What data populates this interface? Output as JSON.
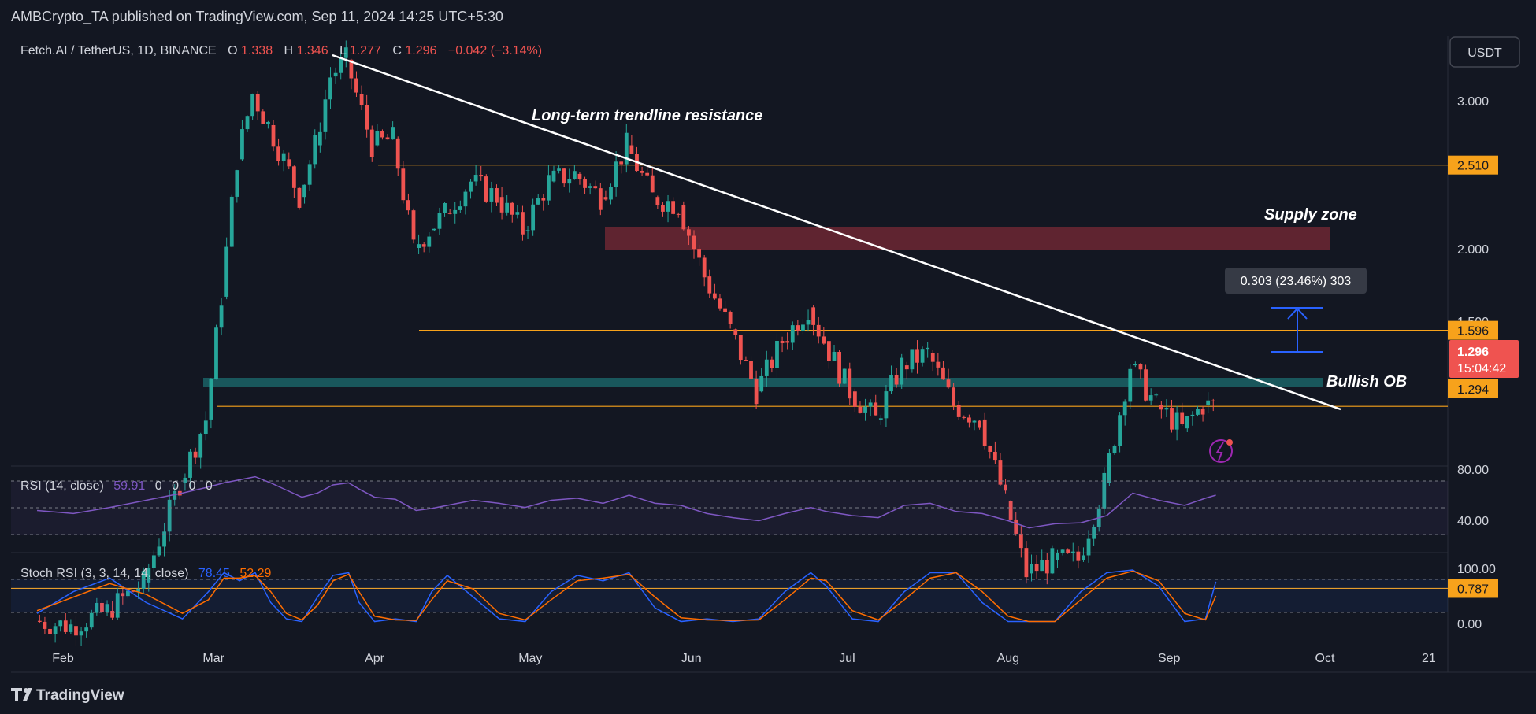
{
  "header": {
    "published_by": "AMBCrypto_TA published on TradingView.com, Sep 11, 2024 14:25 UTC+5:30"
  },
  "legend": {
    "symbol": "Fetch.AI / TetherUS, 1D, BINANCE",
    "o_label": "O",
    "o_value": "1.338",
    "h_label": "H",
    "h_value": "1.346",
    "l_label": "L",
    "l_value": "1.277",
    "c_label": "C",
    "c_value": "1.296",
    "change": "−0.042 (−3.14%)"
  },
  "currency_button": "USDT",
  "footer": {
    "logo_text": "TradingView"
  },
  "colors": {
    "background": "#131722",
    "up": "#26a69a",
    "down": "#ef5350",
    "level_line": "#f7a21b",
    "trendline": "#ffffff",
    "supply_zone": "#7a2a35",
    "bullish_ob": "#1b5e63",
    "rsi": "#7e57c2",
    "stoch_k": "#2962ff",
    "stoch_d": "#ff6d00",
    "measure": "#2962ff"
  },
  "chart_data": [
    {
      "type": "candlestick",
      "title": "Fetch.AI / TetherUS, 1D, BINANCE",
      "x_tick_labels": [
        "Feb",
        "Mar",
        "Apr",
        "May",
        "Jun",
        "Jul",
        "Aug",
        "Sep",
        "Oct",
        "21"
      ],
      "y_tick_labels": [
        "3.000",
        "2.000",
        "1.500"
      ],
      "ylim": [
        0.6,
        3.7
      ],
      "y_scale": "log",
      "grid": false,
      "series": [
        {
          "x": [
            "2024-01-27",
            "2024-02-03",
            "2024-02-10",
            "2024-02-17",
            "2024-02-24",
            "2024-02-29",
            "2024-03-03",
            "2024-03-06",
            "2024-03-09",
            "2024-03-12",
            "2024-03-15",
            "2024-03-18",
            "2024-03-21",
            "2024-03-24",
            "2024-03-27",
            "2024-03-29",
            "2024-04-01",
            "2024-04-05",
            "2024-04-09",
            "2024-04-12",
            "2024-04-15",
            "2024-04-20",
            "2024-04-25",
            "2024-04-30",
            "2024-05-05",
            "2024-05-10",
            "2024-05-15",
            "2024-05-20",
            "2024-05-25",
            "2024-05-30",
            "2024-06-04",
            "2024-06-09",
            "2024-06-14",
            "2024-06-19",
            "2024-06-24",
            "2024-06-27",
            "2024-07-02",
            "2024-07-07",
            "2024-07-12",
            "2024-07-17",
            "2024-07-22",
            "2024-07-27",
            "2024-08-01",
            "2024-08-05",
            "2024-08-10",
            "2024-08-15",
            "2024-08-20",
            "2024-08-25",
            "2024-08-30",
            "2024-09-04",
            "2024-09-08",
            "2024-09-10"
          ],
          "close": [
            0.72,
            0.71,
            0.74,
            0.8,
            1.05,
            1.25,
            1.75,
            2.55,
            3.05,
            2.8,
            2.55,
            2.3,
            2.65,
            3.2,
            3.35,
            3.05,
            2.65,
            2.7,
            2.0,
            2.1,
            2.2,
            2.4,
            2.3,
            2.1,
            2.4,
            2.45,
            2.3,
            2.65,
            2.3,
            2.25,
            1.85,
            1.6,
            1.35,
            1.55,
            1.7,
            1.55,
            1.35,
            1.25,
            1.45,
            1.5,
            1.3,
            1.25,
            1.0,
            0.82,
            0.85,
            0.85,
            1.05,
            1.45,
            1.3,
            1.22,
            1.3,
            1.296
          ]
        }
      ],
      "levels": [
        {
          "label": "2.510",
          "value": 2.51
        },
        {
          "label": "1.596",
          "value": 1.596
        },
        {
          "label": "1.296",
          "value": 1.296
        },
        {
          "label": "1.294",
          "value": 1.294
        },
        {
          "label": "0.787",
          "value": 0.787
        }
      ],
      "price_tag": {
        "value": "1.296",
        "countdown": "15:04:42"
      },
      "annotations": {
        "trendline": "Long-term trendline resistance",
        "supply_zone": "Supply zone",
        "bullish_ob": "Bullish OB",
        "measure": "0.303 (23.46%) 303"
      },
      "zones": [
        {
          "name": "Supply zone",
          "from": 2.0,
          "to": 2.2
        },
        {
          "name": "Bullish OB",
          "from": 1.17,
          "to": 1.21
        }
      ]
    },
    {
      "type": "line",
      "title": "RSI (14, close)",
      "legend_values": [
        "59.91",
        "0",
        "0",
        "0",
        "0"
      ],
      "y_tick_labels": [
        "80.00",
        "40.00"
      ],
      "ylim": [
        20,
        85
      ],
      "band": [
        30,
        70
      ],
      "series": [
        {
          "name": "RSI",
          "values": [
            45,
            42,
            48,
            55,
            62,
            68,
            72,
            75,
            78,
            72,
            65,
            58,
            62,
            70,
            72,
            66,
            58,
            56,
            45,
            47,
            50,
            55,
            52,
            48,
            55,
            57,
            52,
            60,
            52,
            50,
            42,
            38,
            35,
            42,
            48,
            44,
            40,
            38,
            50,
            52,
            44,
            42,
            35,
            28,
            32,
            33,
            40,
            62,
            55,
            50,
            57,
            60
          ]
        }
      ]
    },
    {
      "type": "line",
      "title": "Stoch RSI (3, 3, 14, 14, close)",
      "legend_values": [
        "78.45",
        "52.29"
      ],
      "y_tick_labels": [
        "100.00",
        "0.00"
      ],
      "ylim": [
        -8,
        112
      ],
      "band": [
        20,
        80
      ],
      "series": [
        {
          "name": "K",
          "values": [
            20,
            60,
            85,
            40,
            10,
            60,
            95,
            80,
            95,
            40,
            10,
            5,
            50,
            90,
            95,
            40,
            5,
            10,
            5,
            60,
            90,
            50,
            10,
            5,
            60,
            90,
            80,
            95,
            30,
            5,
            10,
            5,
            10,
            60,
            95,
            70,
            10,
            5,
            60,
            95,
            95,
            40,
            5,
            5,
            5,
            60,
            95,
            100,
            70,
            5,
            10,
            78.45
          ]
        },
        {
          "name": "D",
          "values": [
            25,
            50,
            75,
            55,
            20,
            45,
            85,
            85,
            90,
            60,
            20,
            8,
            35,
            80,
            92,
            60,
            15,
            8,
            7,
            45,
            80,
            65,
            20,
            8,
            45,
            80,
            85,
            92,
            50,
            12,
            8,
            7,
            8,
            45,
            85,
            80,
            25,
            8,
            45,
            85,
            95,
            60,
            15,
            5,
            5,
            45,
            85,
            98,
            80,
            20,
            8,
            52.29
          ]
        }
      ]
    }
  ]
}
